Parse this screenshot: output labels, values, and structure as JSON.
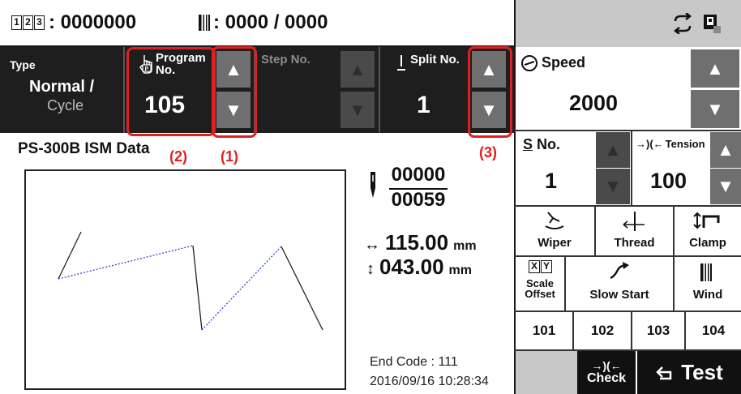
{
  "header": {
    "counter_icon": "counter-123-icon",
    "counter_badge": [
      "1",
      "2",
      "3"
    ],
    "counter_value": ": 0000000",
    "bobbin_icon": "bobbin-spool-icon",
    "bobbin_value": ": 0000 / 0000",
    "right_icons": [
      "sync-arrows-icon",
      "program-storage-icon"
    ]
  },
  "selector": {
    "type_label": "Type",
    "type_value_1": "Normal /",
    "type_value_2": "Cycle",
    "program_label_1": "Program",
    "program_label_2": "No.",
    "program_value": "105",
    "step_label": "Step No.",
    "split_label": "Split No.",
    "split_value": "1",
    "up_glyph": "▲",
    "down_glyph": "▼"
  },
  "annotations": {
    "label_1": "(1)",
    "label_2": "(2)",
    "label_3": "(3)",
    "color": "#e02020"
  },
  "data_area": {
    "title": "PS-300B ISM Data",
    "stitch_current": "00000",
    "stitch_total": "00059",
    "width_value": "115.00",
    "height_value": "043.00",
    "unit": "mm",
    "end_code": "End Code : 111",
    "datetime": "2016/09/16 10:28:34"
  },
  "right": {
    "speed_label": "Speed",
    "speed_value": "2000",
    "sno_label_s": "S",
    "sno_label": "No.",
    "sno_value": "1",
    "tension_label": "Tension",
    "tension_value": "100",
    "tools": [
      {
        "label": "Wiper",
        "icon": "wiper-icon"
      },
      {
        "label": "Thread",
        "icon": "thread-trim-icon"
      },
      {
        "label": "Clamp",
        "icon": "clamp-icon"
      }
    ],
    "tools2": [
      {
        "label1": "Scale",
        "label2": "Offset",
        "icon": "xy-scale-icon"
      },
      {
        "label": "Slow Start",
        "icon": "slow-start-arrow-icon"
      },
      {
        "label": "Wind",
        "icon": "bobbin-wind-icon"
      }
    ],
    "programs": [
      "101",
      "102",
      "103",
      "104"
    ],
    "check_label": "Check",
    "test_label": "Test"
  },
  "colors": {
    "panel_dark": "#1e1e1e",
    "button_gray": "#6f6f6f",
    "button_disabled": "#4a4a4a",
    "stitch_dotted": "#3344cc",
    "highlight_red": "#e02020"
  }
}
